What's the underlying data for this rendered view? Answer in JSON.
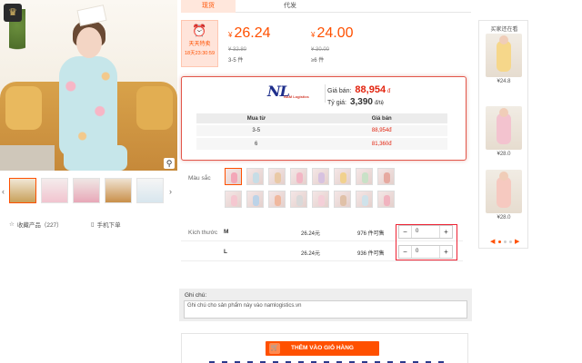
{
  "gallery": {
    "thumbnails": [
      "thumb-1",
      "thumb-2",
      "thumb-3",
      "thumb-4",
      "thumb-5"
    ],
    "left_arrow": "‹",
    "right_arrow": "›",
    "zoom_icon": "magnifier-icon",
    "favorite_label": "收藏产品（227）",
    "phone_order_label": "手机下单"
  },
  "tabs": {
    "active": "现货",
    "other": "代发"
  },
  "price": {
    "timer_label": "天天特卖",
    "timer_time": "18天23:30:59",
    "tiers": [
      {
        "currency": "¥",
        "price": "26.24",
        "old": "¥ 32.80",
        "range": "3-5 件"
      },
      {
        "currency": "¥",
        "price": "24.00",
        "old": "¥ 30.00",
        "range": "≥6 件"
      }
    ]
  },
  "nl": {
    "logo_text": "NL",
    "logo_sub": "NAM Logistics",
    "gia_ban_label": "Giá bán:",
    "gia_ban_value": "88,954",
    "gia_ban_unit": "đ",
    "ty_gia_label": "Tỷ giá:",
    "ty_gia_value": "3,390",
    "ty_gia_unit": "đ/tệ",
    "table": {
      "headers": [
        "Mua từ",
        "Giá bán"
      ],
      "rows": [
        [
          "3-5",
          "88,954đ"
        ],
        [
          "6",
          "81,360đ"
        ]
      ]
    }
  },
  "colors": {
    "label": "Màu sắc",
    "swatch_count": 16
  },
  "sizes": {
    "label": "Kích thước",
    "rows": [
      {
        "name": "M",
        "price": "26.24元",
        "stock": "976 件可售",
        "qty": "0"
      },
      {
        "name": "L",
        "price": "26.24元",
        "stock": "936 件可售",
        "qty": "0"
      }
    ]
  },
  "note": {
    "label": "Ghi chú:",
    "placeholder": "Ghi chú cho sản phẩm này vào namlogistics.vn"
  },
  "cart": {
    "button_label": "THÊM VÀO GIỎ HÀNG"
  },
  "recommend": {
    "title": "买家还在看",
    "items": [
      {
        "price": "¥24.8"
      },
      {
        "price": "¥28.0"
      },
      {
        "price": "¥28.0"
      }
    ],
    "pager_prev": "◀",
    "pager_next": "▶"
  },
  "theme": {
    "accent": "#ff5000",
    "nl_red": "#e2230e",
    "nl_blue": "#1f2f8c"
  }
}
